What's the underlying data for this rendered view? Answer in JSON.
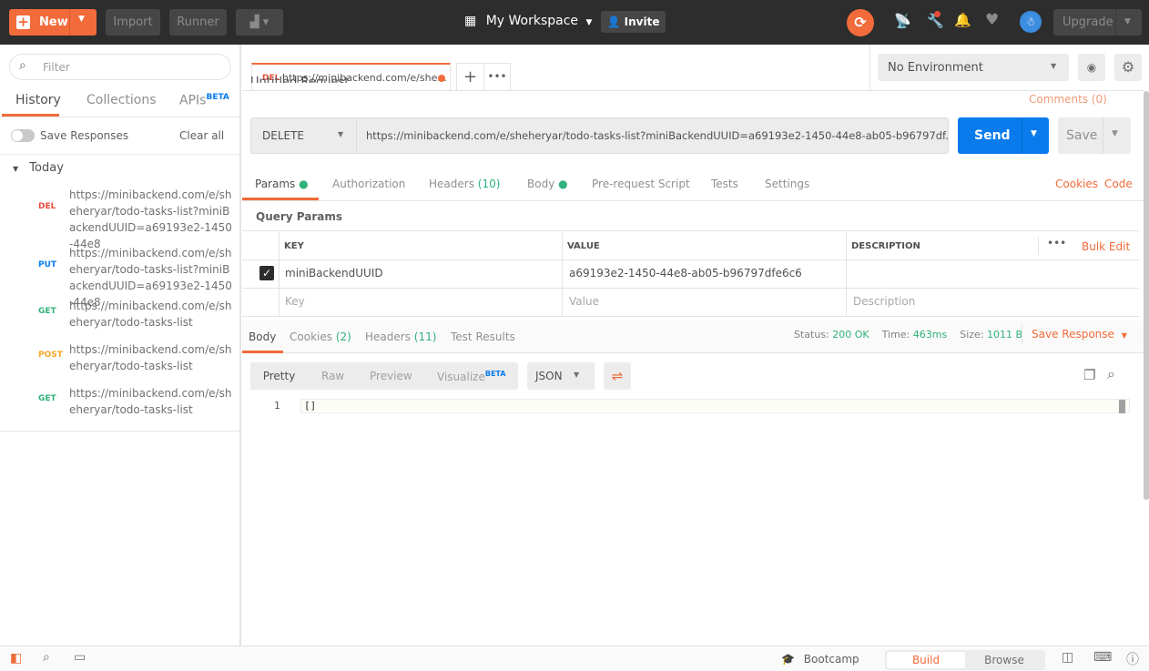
{
  "topbar": {
    "new": "New",
    "import": "Import",
    "runner": "Runner",
    "workspace": "My Workspace",
    "invite": "Invite",
    "upgrade": "Upgrade"
  },
  "sidebar": {
    "filter_placeholder": "Filter",
    "tabs": [
      "History",
      "Collections",
      "APIs"
    ],
    "beta": "BETA",
    "save_responses": "Save Responses",
    "clear_all": "Clear all",
    "group": "Today",
    "items": [
      {
        "method": "DEL",
        "color": "#e84b3c",
        "url": "https://minibackend.com/e/sheheryar/todo-tasks-list?miniBackendUUID=a69193e2-1450-44e8"
      },
      {
        "method": "PUT",
        "color": "#097bed",
        "url": "https://minibackend.com/e/sheheryar/todo-tasks-list?miniBackendUUID=a69193e2-1450-44e8"
      },
      {
        "method": "GET",
        "color": "#30b27a",
        "url": "https://minibackend.com/e/sheheryar/todo-tasks-list"
      },
      {
        "method": "POST",
        "color": "#f5a623",
        "url": "https://minibackend.com/e/sheheryar/todo-tasks-list"
      },
      {
        "method": "GET",
        "color": "#30b27a",
        "url": "https://minibackend.com/e/sheheryar/todo-tasks-list"
      }
    ]
  },
  "request_tab": {
    "method": "DEL",
    "title": "https://minibackend.com/e/she..."
  },
  "request": {
    "name": "Untitled Request",
    "comments": "Comments (0)",
    "method": "DELETE",
    "url": "https://minibackend.com/e/sheheryar/todo-tasks-list?miniBackendUUID=a69193e2-1450-44e8-ab05-b96797df...",
    "send": "Send",
    "save": "Save"
  },
  "environment": {
    "selected": "No Environment"
  },
  "req_tabs": {
    "params": "Params",
    "authorization": "Authorization",
    "headers": "Headers",
    "headers_count": "(10)",
    "body": "Body",
    "prerequest": "Pre-request Script",
    "tests": "Tests",
    "settings": "Settings",
    "cookies": "Cookies",
    "code": "Code"
  },
  "params": {
    "title": "Query Params",
    "columns": [
      "KEY",
      "VALUE",
      "DESCRIPTION"
    ],
    "bulk_edit": "Bulk Edit",
    "rows": [
      {
        "checked": true,
        "key": "miniBackendUUID",
        "value": "a69193e2-1450-44e8-ab05-b96797dfe6c6",
        "description": ""
      }
    ],
    "placeholders": {
      "key": "Key",
      "value": "Value",
      "description": "Description"
    }
  },
  "response": {
    "tabs": {
      "body": "Body",
      "cookies": "Cookies",
      "cookies_count": "(2)",
      "headers": "Headers",
      "headers_count": "(11)",
      "test_results": "Test Results"
    },
    "status_label": "Status:",
    "status": "200 OK",
    "time_label": "Time:",
    "time": "463ms",
    "size_label": "Size:",
    "size": "1011 B",
    "save_response": "Save Response",
    "views": [
      "Pretty",
      "Raw",
      "Preview",
      "Visualize"
    ],
    "beta": "BETA",
    "format": "JSON",
    "line_no": "1",
    "content": "[]"
  },
  "bottombar": {
    "bootcamp": "Bootcamp",
    "build": "Build",
    "browse": "Browse"
  }
}
